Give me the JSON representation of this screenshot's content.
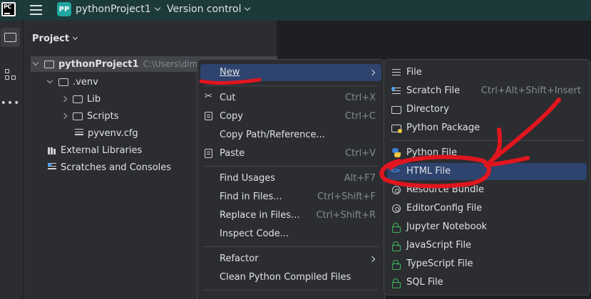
{
  "titlebar": {
    "logo_text": "PC",
    "project_badge": "PP",
    "project_name": "pythonProject1",
    "version_control": "Version control"
  },
  "project_panel": {
    "title": "Project",
    "tree": [
      {
        "label": "pythonProject1",
        "path": "C:\\Users\\dima",
        "icon": "folder-icon",
        "expanded": true
      },
      {
        "label": ".venv",
        "icon": "folder-icon",
        "expanded": true
      },
      {
        "label": "Lib",
        "icon": "folder-icon",
        "expanded": false
      },
      {
        "label": "Scripts",
        "icon": "folder-icon",
        "expanded": false
      },
      {
        "label": "pyvenv.cfg",
        "icon": "config-file-icon"
      },
      {
        "label": "External Libraries",
        "icon": "library-icon"
      },
      {
        "label": "Scratches and Consoles",
        "icon": "scratch-icon"
      }
    ]
  },
  "context_menu": {
    "items": [
      {
        "label": "New",
        "shortcut": "",
        "submenu": true
      },
      {
        "label": "Cut",
        "shortcut": "Ctrl+X",
        "icon": "scissors-icon"
      },
      {
        "label": "Copy",
        "shortcut": "Ctrl+C",
        "icon": "copy-icon"
      },
      {
        "label": "Copy Path/Reference...",
        "shortcut": ""
      },
      {
        "label": "Paste",
        "shortcut": "Ctrl+V",
        "icon": "paste-icon"
      },
      {
        "label": "Find Usages",
        "shortcut": "Alt+F7"
      },
      {
        "label": "Find in Files...",
        "shortcut": "Ctrl+Shift+F"
      },
      {
        "label": "Replace in Files...",
        "shortcut": "Ctrl+Shift+R"
      },
      {
        "label": "Inspect Code...",
        "shortcut": ""
      },
      {
        "label": "Refactor",
        "shortcut": "",
        "submenu": true
      },
      {
        "label": "Clean Python Compiled Files",
        "shortcut": ""
      }
    ]
  },
  "new_submenu": {
    "items": [
      {
        "label": "File",
        "shortcut": "",
        "icon": "file-icon"
      },
      {
        "label": "Scratch File",
        "shortcut": "Ctrl+Alt+Shift+Insert",
        "icon": "scratch-file-icon"
      },
      {
        "label": "Directory",
        "shortcut": "",
        "icon": "directory-icon"
      },
      {
        "label": "Python Package",
        "shortcut": "",
        "icon": "python-package-icon"
      },
      {
        "label": "Python File",
        "shortcut": "",
        "icon": "python-file-icon"
      },
      {
        "label": "HTML File",
        "shortcut": "",
        "icon": "html-file-icon",
        "highlighted": true
      },
      {
        "label": "Resource Bundle",
        "shortcut": "",
        "icon": "resource-bundle-icon"
      },
      {
        "label": "EditorConfig File",
        "shortcut": "",
        "icon": "editorconfig-icon"
      },
      {
        "label": "Jupyter Notebook",
        "shortcut": "",
        "icon": "lock-icon"
      },
      {
        "label": "JavaScript File",
        "shortcut": "",
        "icon": "lock-icon"
      },
      {
        "label": "TypeScript File",
        "shortcut": "",
        "icon": "lock-icon"
      },
      {
        "label": "SQL File",
        "shortcut": "",
        "icon": "lock-icon"
      }
    ]
  },
  "annotation": {
    "color": "#e0161f"
  }
}
